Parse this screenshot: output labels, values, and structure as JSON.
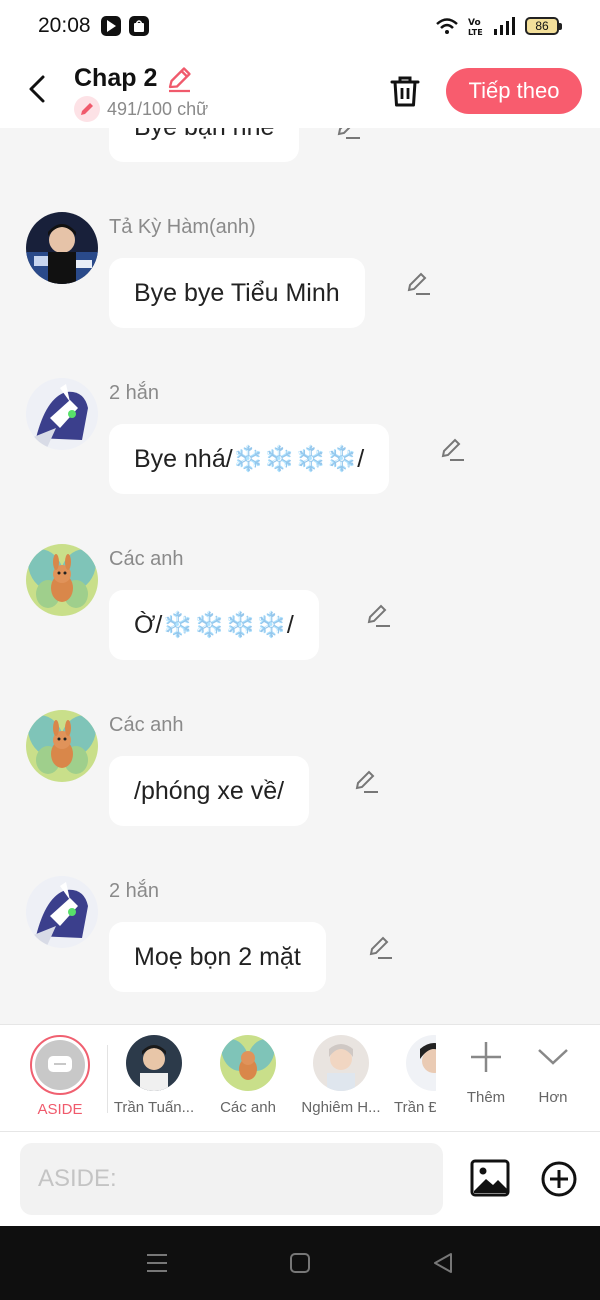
{
  "status_bar": {
    "time": "20:08",
    "battery": "86",
    "icons": [
      "play-app-icon",
      "shopee-app-icon",
      "wifi-icon",
      "volte-icon",
      "signal-icon",
      "battery-icon"
    ]
  },
  "header": {
    "title": "Chap 2",
    "word_count": "491/100 chữ",
    "next_label": "Tiếp theo",
    "accent_color": "#f85c6e"
  },
  "partial_message": {
    "text": "Bye bạn nhé"
  },
  "messages": [
    {
      "sender": "Tả Kỳ Hàm(anh)",
      "text": "Bye bye Tiểu Minh",
      "avatar": "photo-avatar"
    },
    {
      "sender": "2 hắn",
      "text": "Bye nhá/❄️❄️❄️❄️/",
      "avatar": "robot-avatar"
    },
    {
      "sender": "Các anh",
      "text": "Ờ/❄️❄️❄️❄️/",
      "avatar": "fairy-avatar"
    },
    {
      "sender": "Các anh",
      "text": "/phóng xe về/",
      "avatar": "fairy-avatar"
    },
    {
      "sender": "2 hắn",
      "text": "Moẹ bọn 2 mặt",
      "avatar": "robot-avatar"
    }
  ],
  "characters": [
    {
      "label": "ASIDE",
      "selected": true
    },
    {
      "label": "Trần Tuấn..."
    },
    {
      "label": "Các anh"
    },
    {
      "label": "Nghiêm H..."
    },
    {
      "label": "Trần Đ"
    }
  ],
  "strip_actions": {
    "add_label": "Thêm",
    "more_label": "Hơn"
  },
  "input": {
    "placeholder": "ASIDE:",
    "value": ""
  }
}
